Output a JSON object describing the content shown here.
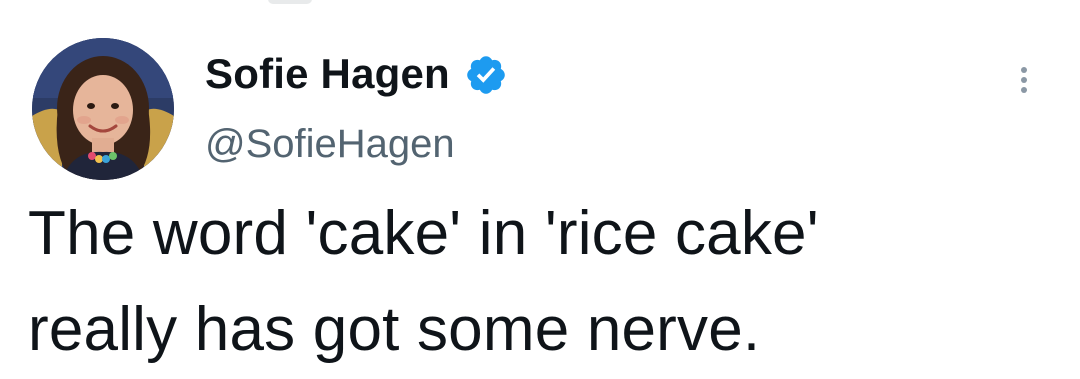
{
  "author": {
    "display_name": "Sofie Hagen",
    "handle": "@SofieHagen",
    "verified": true
  },
  "icons": {
    "verified": "verified-badge-icon",
    "more": "more-options-icon",
    "avatar": "profile-avatar"
  },
  "tweet": {
    "lines": [
      "The word 'cake' in 'rice cake'",
      "really has got some nerve."
    ]
  },
  "colors": {
    "text": "#0f1419",
    "handle": "#536471",
    "verified": "#1d9bf0",
    "more_dots": "#8b98a5"
  }
}
